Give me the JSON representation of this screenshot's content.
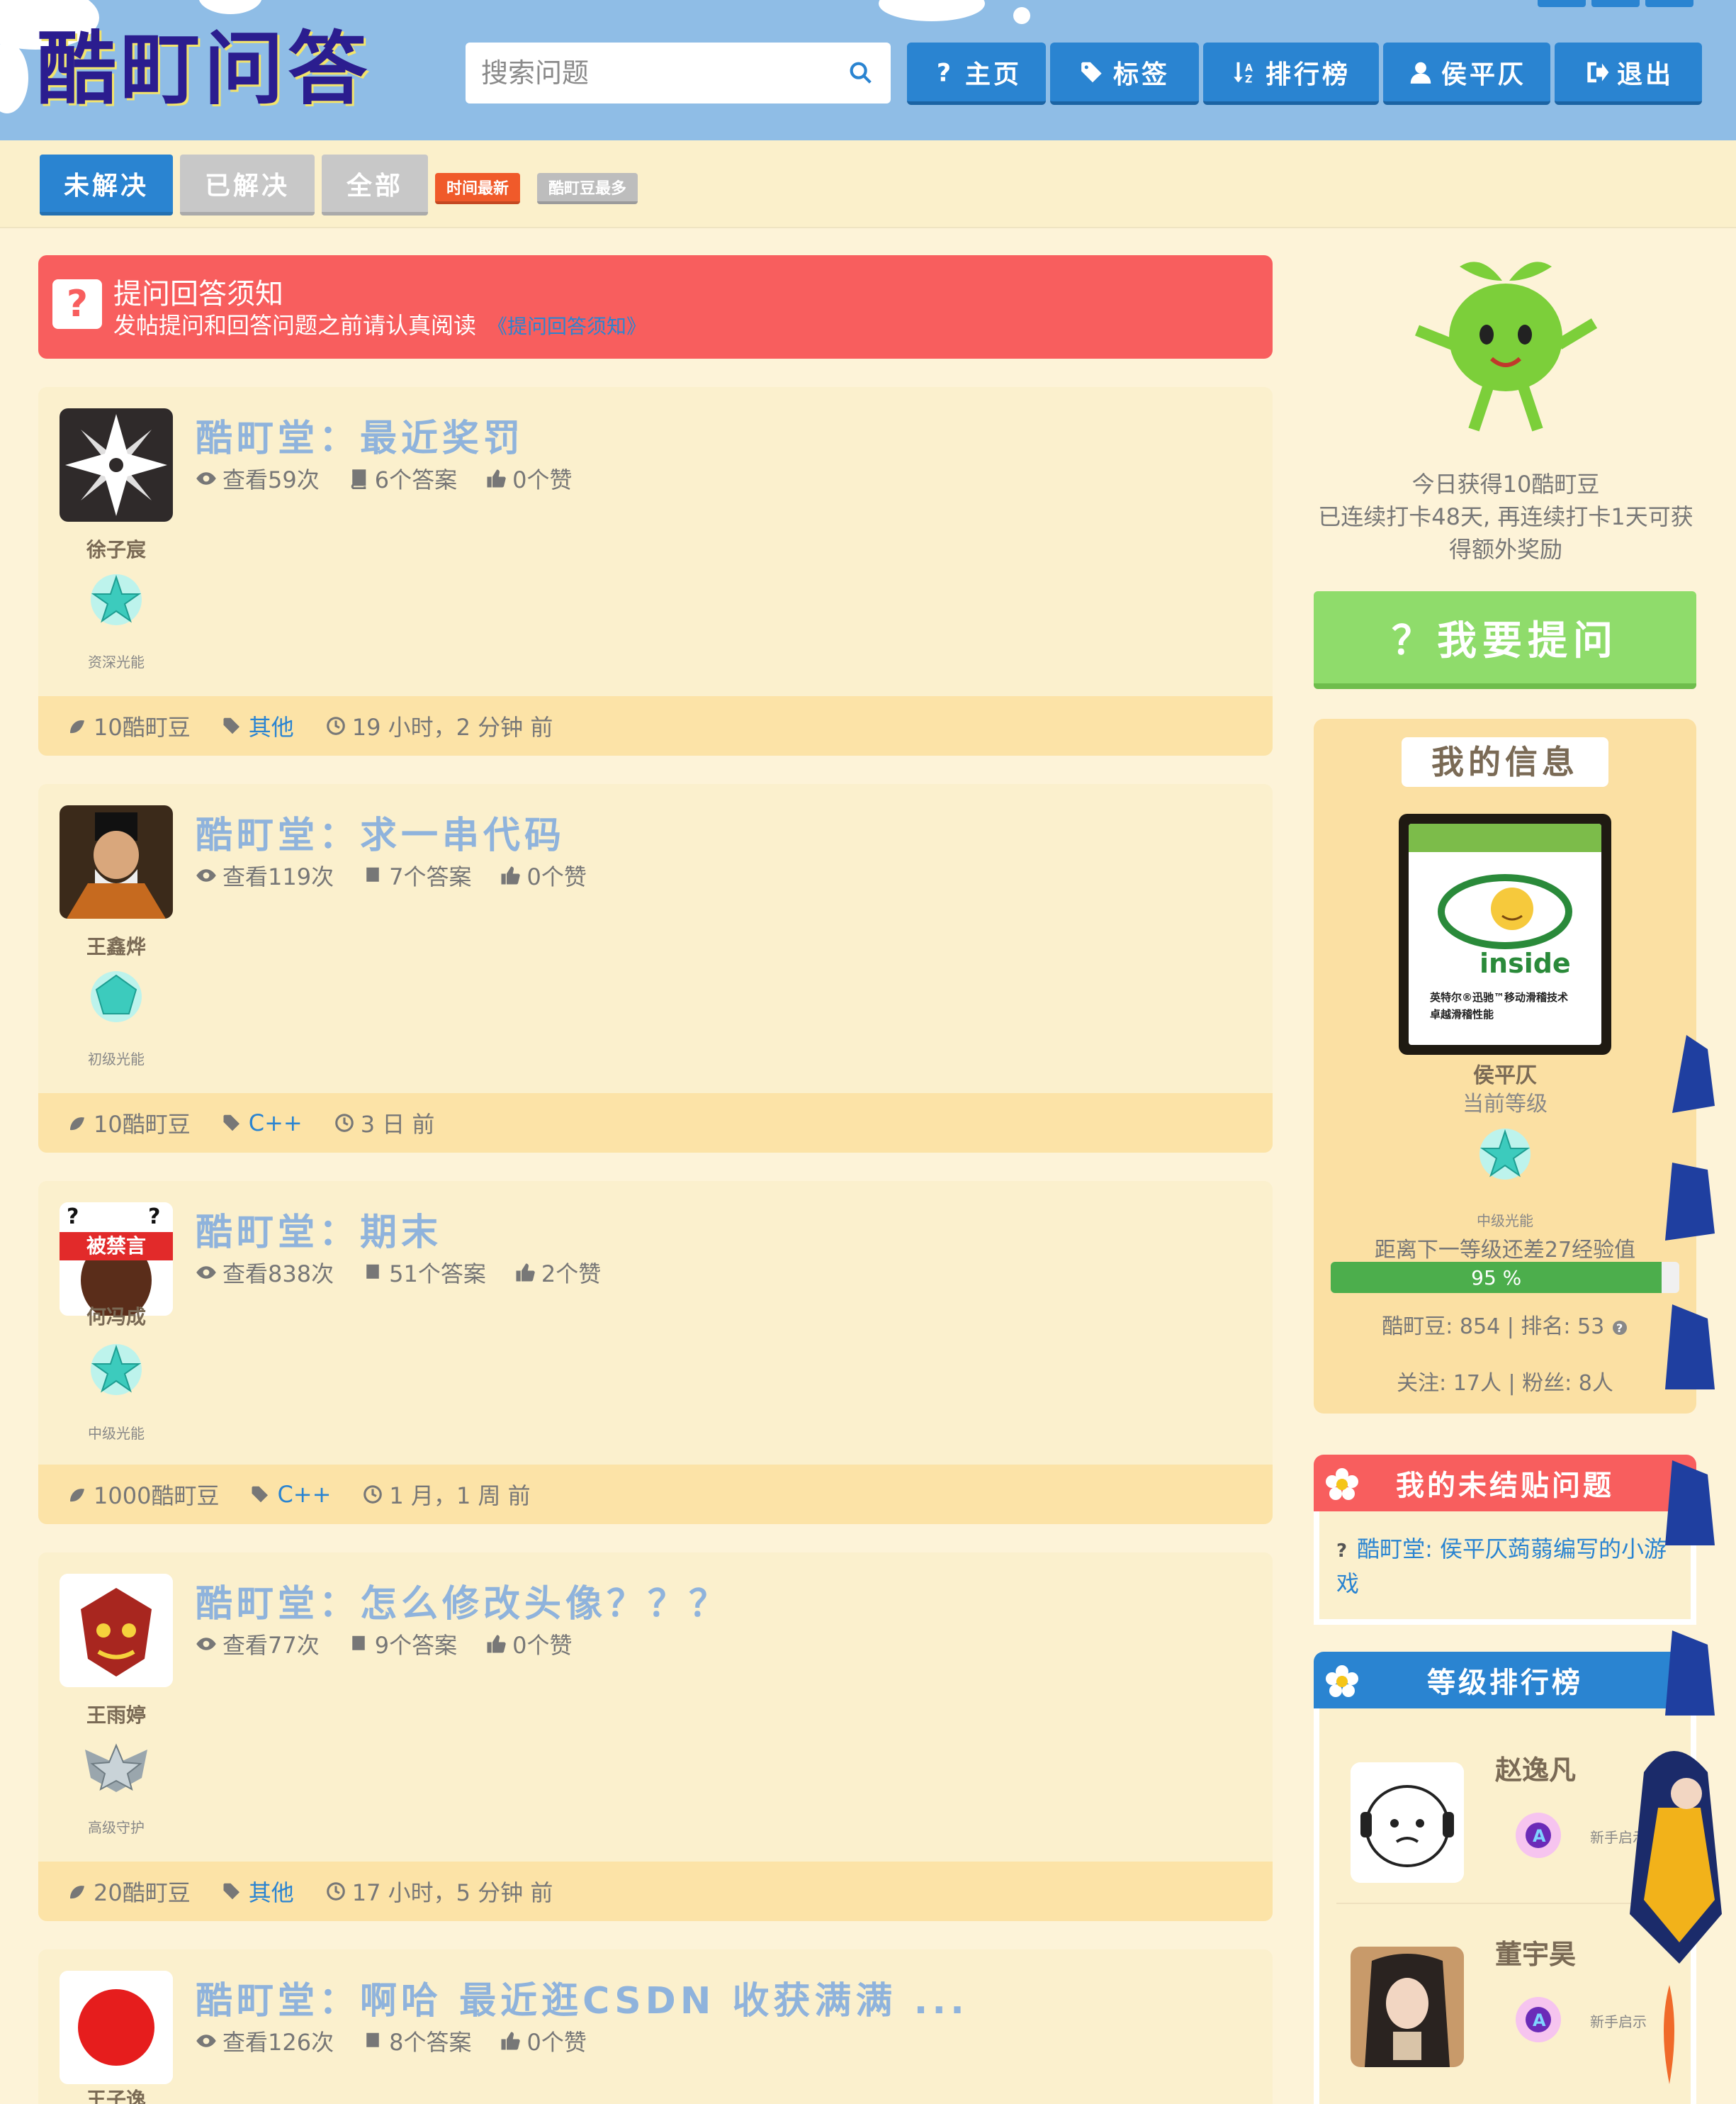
{
  "header": {
    "logo_text": "酷町问答",
    "search_placeholder": "搜索问题",
    "nav": [
      {
        "icon": "question-icon",
        "label": "主页"
      },
      {
        "icon": "tags-icon",
        "label": "标签"
      },
      {
        "icon": "sort-icon",
        "label": "排行榜"
      },
      {
        "icon": "user-icon",
        "label": "侯平仄"
      },
      {
        "icon": "logout-icon",
        "label": "退出"
      }
    ]
  },
  "filters": {
    "tabs": [
      "未解决",
      "已解决",
      "全部"
    ],
    "sort": [
      "时间最新",
      "酷町豆最多"
    ]
  },
  "notice": {
    "title": "提问回答须知",
    "text": "发帖提问和回答问题之前请认真阅读",
    "link": "《提问回答须知》"
  },
  "posts": [
    {
      "user": "徐子宸",
      "level": "资深光能",
      "title": "酷町堂：最近奖罚",
      "views": "查看59次",
      "answers": "6个答案",
      "likes": "0个赞",
      "beans": "10酷町豆",
      "tag": "其他",
      "time": "19 小时，2 分钟 前"
    },
    {
      "user": "王鑫烨",
      "level": "初级光能",
      "title": "酷町堂：求一串代码",
      "views": "查看119次",
      "answers": "7个答案",
      "likes": "0个赞",
      "beans": "10酷町豆",
      "tag": "C++",
      "time": "3 日 前"
    },
    {
      "user": "何冯成",
      "level": "中级光能",
      "title": "酷町堂：期末",
      "views": "查看838次",
      "answers": "51个答案",
      "likes": "2个赞",
      "beans": "1000酷町豆",
      "tag": "C++",
      "time": "1 月，1 周 前",
      "muted": "被禁言"
    },
    {
      "user": "王雨婷",
      "level": "高级守护",
      "title": "酷町堂：怎么修改头像？？？",
      "views": "查看77次",
      "answers": "9个答案",
      "likes": "0个赞",
      "beans": "20酷町豆",
      "tag": "其他",
      "time": "17 小时，5 分钟 前"
    },
    {
      "user": "王子逸",
      "level": "",
      "title": "酷町堂：啊哈 最近逛CSDN 收获满满 ...",
      "views": "查看126次",
      "answers": "8个答案",
      "likes": "0个赞",
      "beans": "",
      "tag": "",
      "time": ""
    }
  ],
  "sidebar": {
    "checkin_line1": "今日获得10酷町豆",
    "checkin_line2": "已连续打卡48天, 再连续打卡1天可获",
    "checkin_line3": "得额外奖励",
    "ask_button": "？我要提问",
    "myinfo": {
      "title": "我的信息",
      "pic_text": "inside",
      "pic_caption1": "英特尔®迅驰™移动滑稽技术",
      "pic_caption2": "卓越滑稽性能",
      "name": "侯平仄",
      "current_level_label": "当前等级",
      "level_name": "中级光能",
      "exp_text": "距离下一等级还差27经验值",
      "progress_percent": 95,
      "progress_text": "95 %",
      "beans_text": "酷町豆: 854 | 排名: 53",
      "follow_text": "关注: 17人 | 粉丝: 8人"
    },
    "unfinished": {
      "title": "我的未结贴问题",
      "item": "酷町堂: 侯平仄蒟蒻编写的小游戏"
    },
    "ranking": {
      "title": "等级排行榜",
      "items": [
        {
          "name": "赵逸凡",
          "level": "新手启示"
        },
        {
          "name": "董宇昊",
          "level": "新手启示"
        }
      ]
    }
  },
  "colors": {
    "header_bg": "#8fbde6",
    "nav_blue": "#2a84d1",
    "notice_red": "#f85e5e",
    "card_bg": "#fbf0cd",
    "card_footer": "#fce3a7",
    "ask_green": "#8fdc6b",
    "panel_red": "#f85e5e",
    "panel_blue": "#2a84d1"
  }
}
